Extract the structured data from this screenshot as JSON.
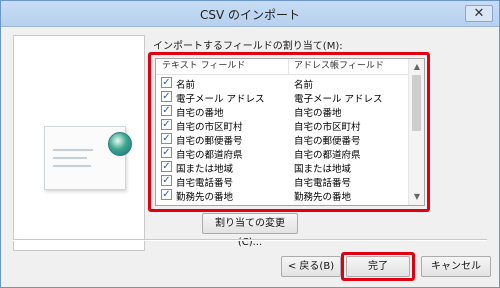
{
  "window": {
    "title": "CSV のインポート",
    "close_label": "✕"
  },
  "assign_label": "インポートするフィールドの割り当て(M):",
  "field_list": {
    "col_text": "テキスト フィールド",
    "col_address": "アドレス帳フィールド",
    "rows": [
      {
        "left": "名前",
        "right": "名前",
        "checked": true
      },
      {
        "left": "電子メール アドレス",
        "right": "電子メール アドレス",
        "checked": true
      },
      {
        "left": "自宅の番地",
        "right": "自宅の番地",
        "checked": true
      },
      {
        "left": "自宅の市区町村",
        "right": "自宅の市区町村",
        "checked": true
      },
      {
        "left": "自宅の郵便番号",
        "right": "自宅の郵便番号",
        "checked": true
      },
      {
        "left": "自宅の都道府県",
        "right": "自宅の都道府県",
        "checked": true
      },
      {
        "left": "国または地域",
        "right": "国または地域",
        "checked": true
      },
      {
        "left": "自宅電話番号",
        "right": "自宅電話番号",
        "checked": true
      },
      {
        "left": "勤務先の番地",
        "right": "勤務先の番地",
        "checked": true
      }
    ]
  },
  "buttons": {
    "change_mapping": "割り当ての変更(C)...",
    "back": "< 戻る(B)",
    "finish": "完了",
    "cancel": "キャンセル"
  },
  "colors": {
    "highlight": "#e00012",
    "titlebar": "#c8ddf4"
  }
}
